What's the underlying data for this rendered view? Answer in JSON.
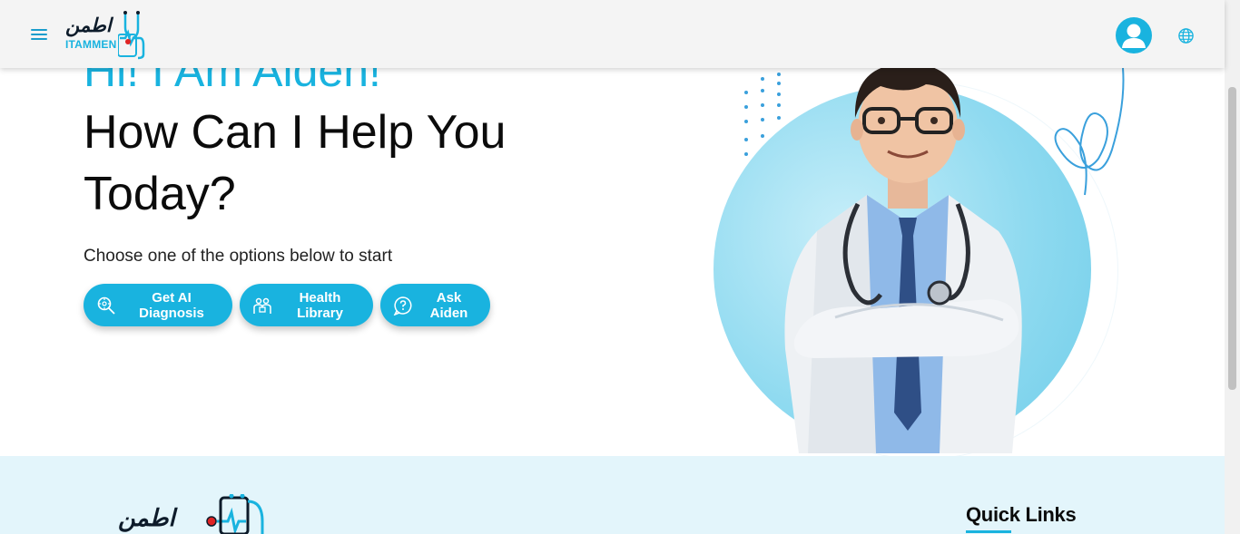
{
  "header": {
    "logo_ar": "اطمن",
    "logo_en": "ITAMMEN",
    "menu_icon": "hamburger-menu-icon",
    "avatar_icon": "user-avatar-icon",
    "language_icon": "globe-icon"
  },
  "hero": {
    "greeting": "Hi! I Am Aiden!",
    "title": "How Can I Help You Today?",
    "subtitle": "Choose one of the options below to start",
    "buttons": [
      {
        "label": "Get AI Diagnosis",
        "icon": "ai-diagnosis-icon"
      },
      {
        "label": "Health Library",
        "icon": "health-library-icon"
      },
      {
        "label": "Ask Aiden",
        "icon": "question-bubble-icon"
      }
    ]
  },
  "footer": {
    "logo_ar": "اطمن",
    "quick_links_title": "Quick Links"
  },
  "colors": {
    "accent": "#19b3df",
    "header_bg": "#f4f4f4",
    "footer_bg": "#e3f5fb",
    "text_dark": "#0b0b0b"
  }
}
